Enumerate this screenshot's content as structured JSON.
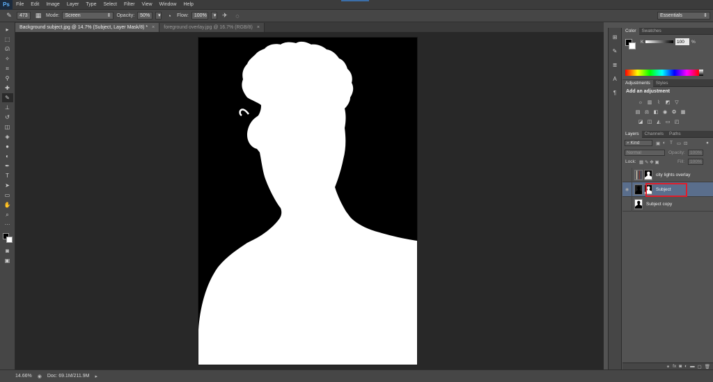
{
  "app": {
    "logo": "Ps",
    "menu": [
      "File",
      "Edit",
      "Image",
      "Layer",
      "Type",
      "Select",
      "Filter",
      "View",
      "Window",
      "Help"
    ]
  },
  "options": {
    "brush_size": "473",
    "mode_label": "Mode:",
    "mode_value": "Screen",
    "opacity_label": "Opacity:",
    "opacity_value": "50%",
    "flow_label": "Flow:",
    "flow_value": "100%",
    "workspace": "Essentials"
  },
  "tabs": [
    {
      "label": "Background subject.jpg @ 14.7% (Subject, Layer Mask/8) *",
      "active": true
    },
    {
      "label": "foreground overlay.jpg @ 16.7% (RGB/8)",
      "active": false
    }
  ],
  "status": {
    "zoom": "14.66%",
    "doc": "Doc: 69.1M/211.9M"
  },
  "color_panel": {
    "tabs": [
      "Color",
      "Swatches"
    ],
    "channel": "K",
    "value": "100",
    "unit": "%"
  },
  "adjustments_panel": {
    "tabs": [
      "Adjustments",
      "Styles"
    ],
    "title": "Add an adjustment"
  },
  "layers_panel": {
    "tabs": [
      "Layers",
      "Channels",
      "Paths"
    ],
    "kind": "Kind",
    "blend_mode": "Normal",
    "opacity_label": "Opacity:",
    "opacity_value": "100%",
    "lock_label": "Lock:",
    "fill_label": "Fill:",
    "fill_value": "100%",
    "layers": [
      {
        "name": "city lights overlay",
        "selected": false
      },
      {
        "name": "Subject",
        "selected": true
      },
      {
        "name": "Subject copy",
        "selected": false
      }
    ]
  },
  "colors": {
    "highlight": "#e11d2a",
    "selected_layer": "#5a6e8c"
  }
}
